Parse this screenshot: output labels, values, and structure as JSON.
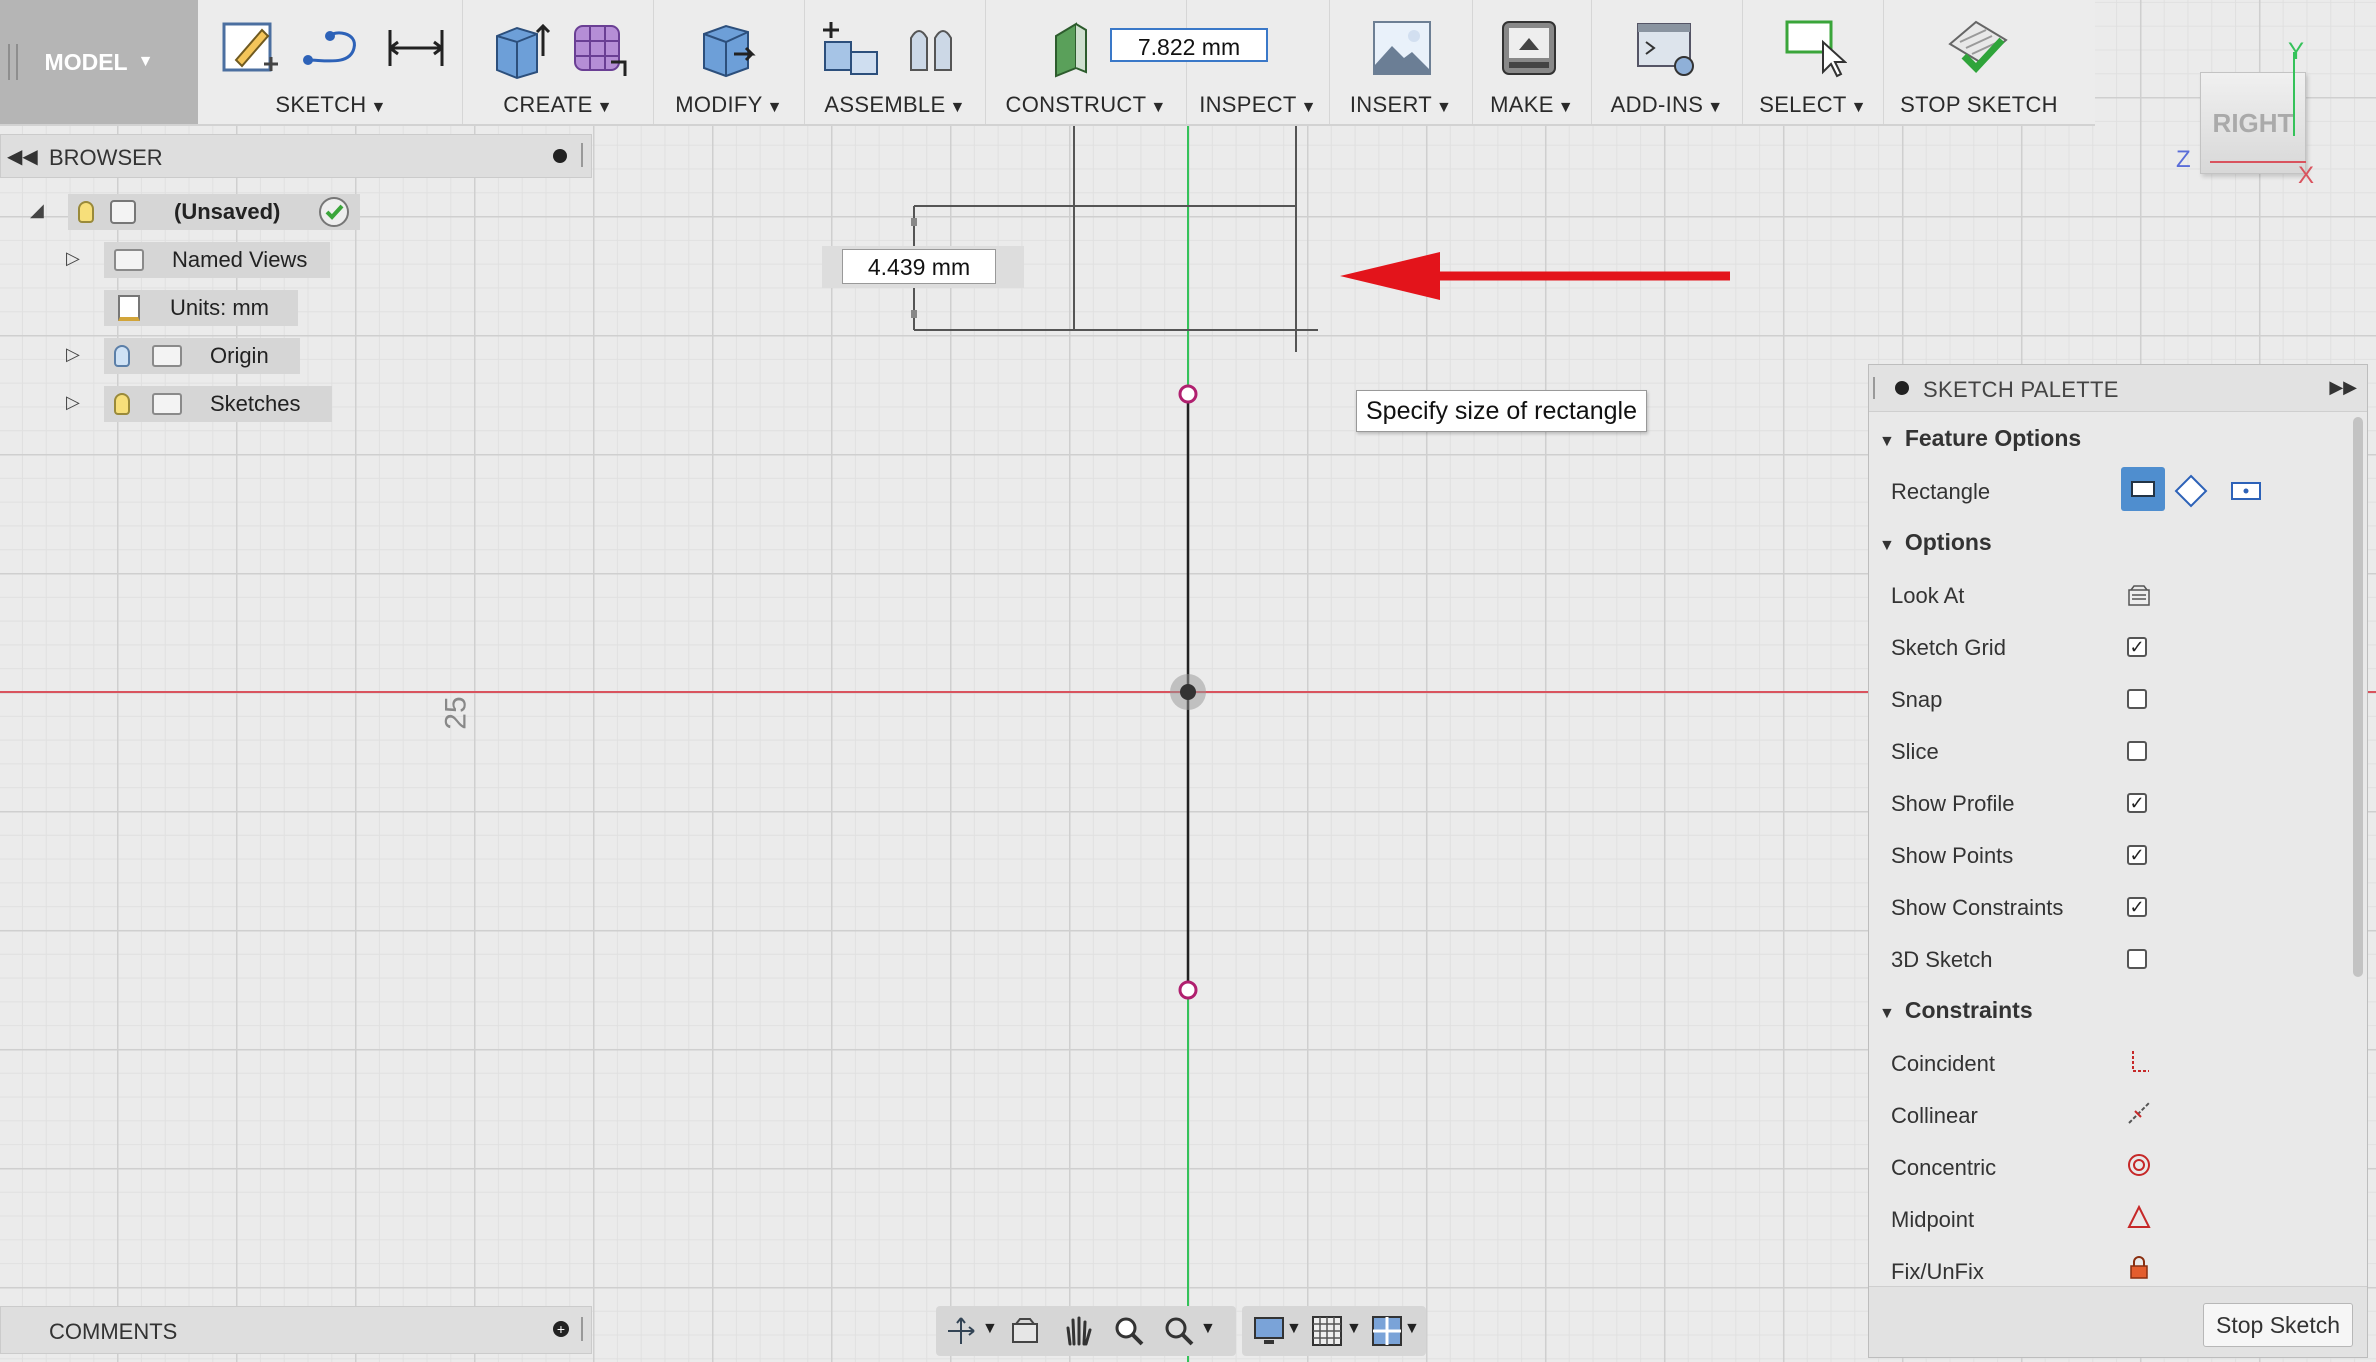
{
  "toolbar": {
    "model_label": "MODEL",
    "groups": {
      "sketch": "SKETCH",
      "create": "CREATE",
      "modify": "MODIFY",
      "assemble": "ASSEMBLE",
      "construct": "CONSTRUCT",
      "inspect": "INSPECT",
      "insert": "INSERT",
      "make": "MAKE",
      "addins": "ADD-INS",
      "select": "SELECT",
      "stop_sketch": "STOP SKETCH"
    },
    "construct_value": "7.822 mm"
  },
  "browser": {
    "title": "BROWSER",
    "root": "(Unsaved)",
    "items": [
      {
        "label": "Named Views"
      },
      {
        "label": "Units: mm"
      },
      {
        "label": "Origin"
      },
      {
        "label": "Sketches"
      }
    ]
  },
  "canvas": {
    "dimension_value": "4.439 mm",
    "tooltip": "Specify size of rectangle",
    "grid_label": "25",
    "colors": {
      "x_axis": "#d9535e",
      "y_axis": "#35c25a",
      "arrow": "#e3141b",
      "points": "#b0206f"
    }
  },
  "viewcube": {
    "face": "RIGHT",
    "axis_y": "Y",
    "axis_z": "Z",
    "axis_x": "X"
  },
  "palette": {
    "title": "SKETCH PALETTE",
    "sections": {
      "feature_options": "Feature Options",
      "options": "Options",
      "constraints": "Constraints"
    },
    "feature_rows": {
      "rectangle": "Rectangle"
    },
    "option_rows": [
      {
        "label": "Look At"
      },
      {
        "label": "Sketch Grid",
        "checked": true
      },
      {
        "label": "Snap",
        "checked": false
      },
      {
        "label": "Slice",
        "checked": false
      },
      {
        "label": "Show Profile",
        "checked": true
      },
      {
        "label": "Show Points",
        "checked": true
      },
      {
        "label": "Show Constraints",
        "checked": true
      },
      {
        "label": "3D Sketch",
        "checked": false
      }
    ],
    "constraint_rows": [
      {
        "label": "Coincident"
      },
      {
        "label": "Collinear"
      },
      {
        "label": "Concentric"
      },
      {
        "label": "Midpoint"
      },
      {
        "label": "Fix/UnFix"
      }
    ],
    "stop_button": "Stop Sketch"
  },
  "comments": {
    "title": "COMMENTS"
  }
}
